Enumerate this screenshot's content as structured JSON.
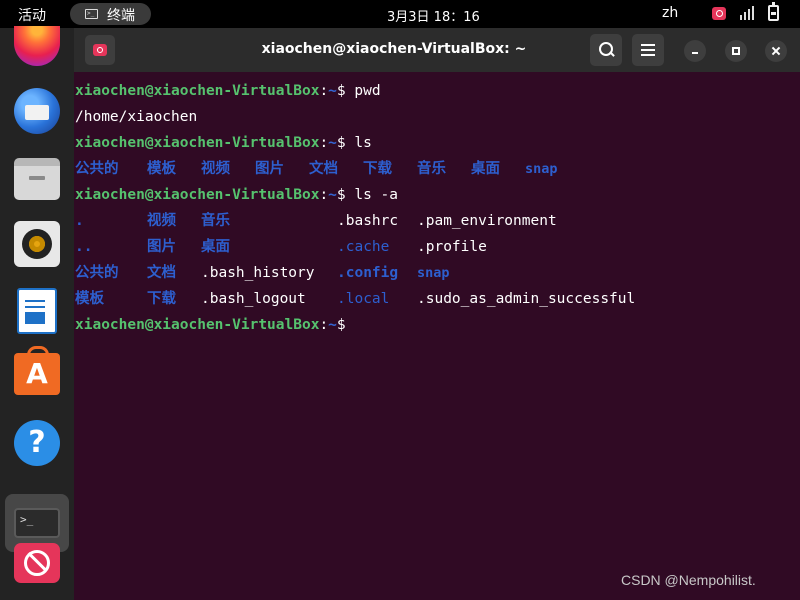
{
  "topbar": {
    "activities": "活动",
    "app_name": "终端",
    "app_icon": ">_",
    "clock": "3月3日  18：16",
    "language": "zh",
    "tray_icons": [
      "screen-recorder-icon",
      "network-icon",
      "battery-icon"
    ]
  },
  "dock": {
    "items": [
      "firefox-icon",
      "thunderbird-icon",
      "files-icon",
      "rhythmbox-icon",
      "libreoffice-writer-icon",
      "ubuntu-software-icon",
      "help-icon",
      "terminal-icon",
      "screen-recorder-icon"
    ],
    "help_glyph": "?",
    "software_glyph": "A",
    "terminal_glyph": ">_"
  },
  "window": {
    "title": "xiaochen@xiaochen-VirtualBox: ~"
  },
  "terminal": {
    "user_host": "xiaochen@xiaochen-VirtualBox",
    "path": "~",
    "colon": ":",
    "prompt_char": "$",
    "cmd1": " pwd",
    "out_pwd": "/home/xiaochen",
    "cmd2": " ls",
    "ls": [
      "公共的",
      "模板",
      "视频",
      "图片",
      "文档",
      "下载",
      "音乐",
      "桌面",
      "snap"
    ],
    "cmd3": " ls -a",
    "lsa": {
      "r1": [
        ".",
        "视频",
        "音乐",
        ".bashrc",
        ".pam_environment"
      ],
      "r2": [
        "..",
        "图片",
        "桌面",
        ".cache",
        ".profile"
      ],
      "r3": [
        "公共的",
        "文档",
        ".bash_history",
        ".config",
        "snap"
      ],
      "r4": [
        "模板",
        "下载",
        ".bash_logout",
        ".local",
        ".sudo_as_admin_successful"
      ]
    }
  },
  "watermark": "CSDN @Nempohilist."
}
